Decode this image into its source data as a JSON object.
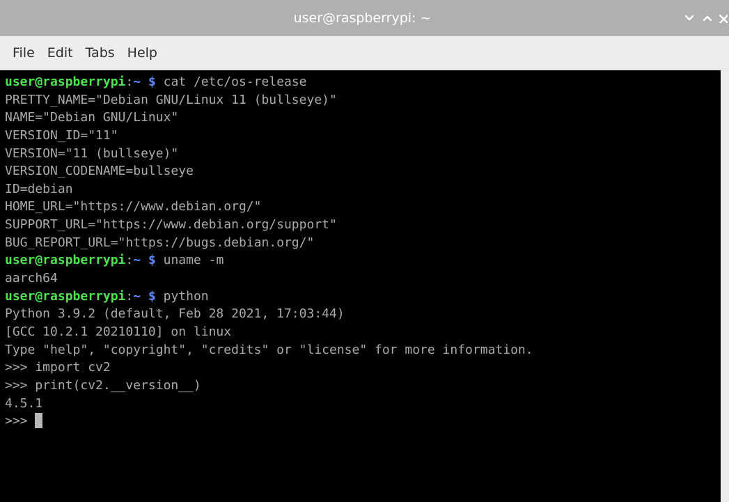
{
  "window": {
    "title": "user@raspberrypi: ~"
  },
  "window_controls": [
    {
      "name": "minimize",
      "icon": "chevron-down-icon",
      "glyph": "v"
    },
    {
      "name": "maximize",
      "icon": "chevron-up-icon",
      "glyph": "^"
    },
    {
      "name": "close",
      "icon": "close-icon",
      "glyph": "x"
    }
  ],
  "menu": {
    "items": [
      "File",
      "Edit",
      "Tabs",
      "Help"
    ]
  },
  "terminal": {
    "colors": {
      "background": "#000000",
      "text": "#aaaaaa",
      "prompt_user": "#4ee24e",
      "prompt_path": "#5c8cff"
    },
    "prompt": {
      "user_host": "user@raspberrypi",
      "separator": ":",
      "path": "~",
      "dollar": "$"
    },
    "lines": [
      {
        "type": "prompt",
        "cmd": "cat /etc/os-release"
      },
      {
        "type": "output",
        "text": "PRETTY_NAME=\"Debian GNU/Linux 11 (bullseye)\""
      },
      {
        "type": "output",
        "text": "NAME=\"Debian GNU/Linux\""
      },
      {
        "type": "output",
        "text": "VERSION_ID=\"11\""
      },
      {
        "type": "output",
        "text": "VERSION=\"11 (bullseye)\""
      },
      {
        "type": "output",
        "text": "VERSION_CODENAME=bullseye"
      },
      {
        "type": "output",
        "text": "ID=debian"
      },
      {
        "type": "output",
        "text": "HOME_URL=\"https://www.debian.org/\""
      },
      {
        "type": "output",
        "text": "SUPPORT_URL=\"https://www.debian.org/support\""
      },
      {
        "type": "output",
        "text": "BUG_REPORT_URL=\"https://bugs.debian.org/\""
      },
      {
        "type": "prompt",
        "cmd": "uname -m"
      },
      {
        "type": "output",
        "text": "aarch64"
      },
      {
        "type": "prompt",
        "cmd": "python"
      },
      {
        "type": "output",
        "text": "Python 3.9.2 (default, Feb 28 2021, 17:03:44)"
      },
      {
        "type": "output",
        "text": "[GCC 10.2.1 20210110] on linux"
      },
      {
        "type": "output",
        "text": "Type \"help\", \"copyright\", \"credits\" or \"license\" for more information."
      },
      {
        "type": "output",
        "text": ">>> import cv2"
      },
      {
        "type": "output",
        "text": ">>> print(cv2.__version__)"
      },
      {
        "type": "output",
        "text": "4.5.1"
      },
      {
        "type": "input",
        "text": ">>> "
      }
    ]
  }
}
